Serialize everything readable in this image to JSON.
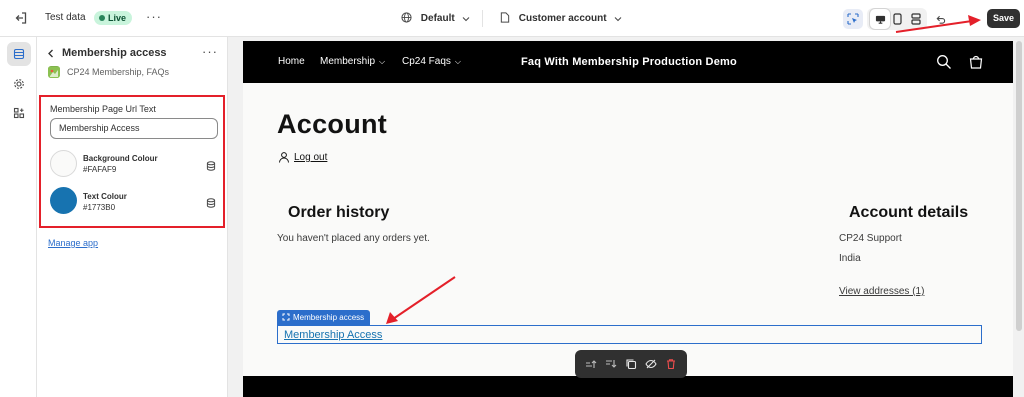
{
  "topbar": {
    "theme_name": "Test data",
    "status": "Live",
    "template_selector": "Default",
    "page_selector": "Customer account",
    "save_label": "Save"
  },
  "sidebar": {
    "title": "Membership access",
    "app_name": "CP24 Membership, FAQs",
    "field_label": "Membership Page Url Text",
    "field_value": "Membership Access",
    "colors": [
      {
        "name": "Background Colour",
        "value": "#FAFAF9",
        "hex": "#fafaf9"
      },
      {
        "name": "Text Colour",
        "value": "#1773B0",
        "hex": "#1773b0"
      }
    ],
    "manage_app": "Manage app"
  },
  "store": {
    "nav": [
      "Home",
      "Membership",
      "Cp24 Faqs"
    ],
    "brand": "Faq With Membership Production Demo",
    "heading": "Account",
    "logout": "Log out",
    "order_history": {
      "title": "Order history",
      "empty": "You haven't placed any orders yet."
    },
    "account_details": {
      "title": "Account details",
      "name": "CP24 Support",
      "country": "India",
      "addresses": "View addresses (1)"
    },
    "block_tag": "Membership access",
    "membership_link": "Membership Access"
  },
  "colors": {
    "annotation_red": "#e4202a",
    "selection_blue": "#2c6ecb",
    "link_color": "#1773b0"
  }
}
